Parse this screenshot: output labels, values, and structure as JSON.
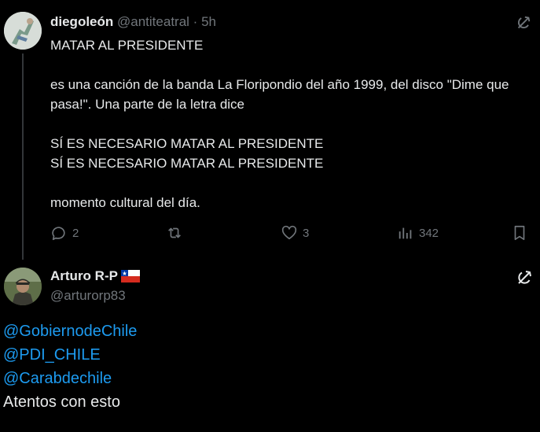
{
  "parent_tweet": {
    "author_name": "diegoleón",
    "author_handle": "@antiteatral",
    "separator": "·",
    "time": "5h",
    "lines": [
      "MATAR AL PRESIDENTE",
      "",
      "es una canción de la banda La Floripondio del año 1999, del disco \"Dime que pasa!\". Una parte de la letra dice",
      "",
      "SÍ ES NECESARIO MATAR AL PRESIDENTE",
      "SÍ ES NECESARIO MATAR AL PRESIDENTE",
      "",
      "momento cultural del día."
    ],
    "stats": {
      "replies": "2",
      "retweets": "",
      "likes": "3",
      "views": "342"
    }
  },
  "reply_tweet": {
    "author_name": "Arturo R-P",
    "author_handle": "@arturorp83",
    "mentions": [
      "@GobiernodeChile",
      "@PDI_CHILE",
      "@Carabdechile"
    ],
    "text": "Atentos con esto"
  },
  "colors": {
    "background": "#000000",
    "text": "#e7e9ea",
    "muted": "#71767b",
    "link": "#1d9bf0"
  },
  "icons": [
    "reply-icon",
    "retweet-icon",
    "like-icon",
    "views-icon",
    "bookmark-icon",
    "grok-icon",
    "chile-flag-icon"
  ]
}
